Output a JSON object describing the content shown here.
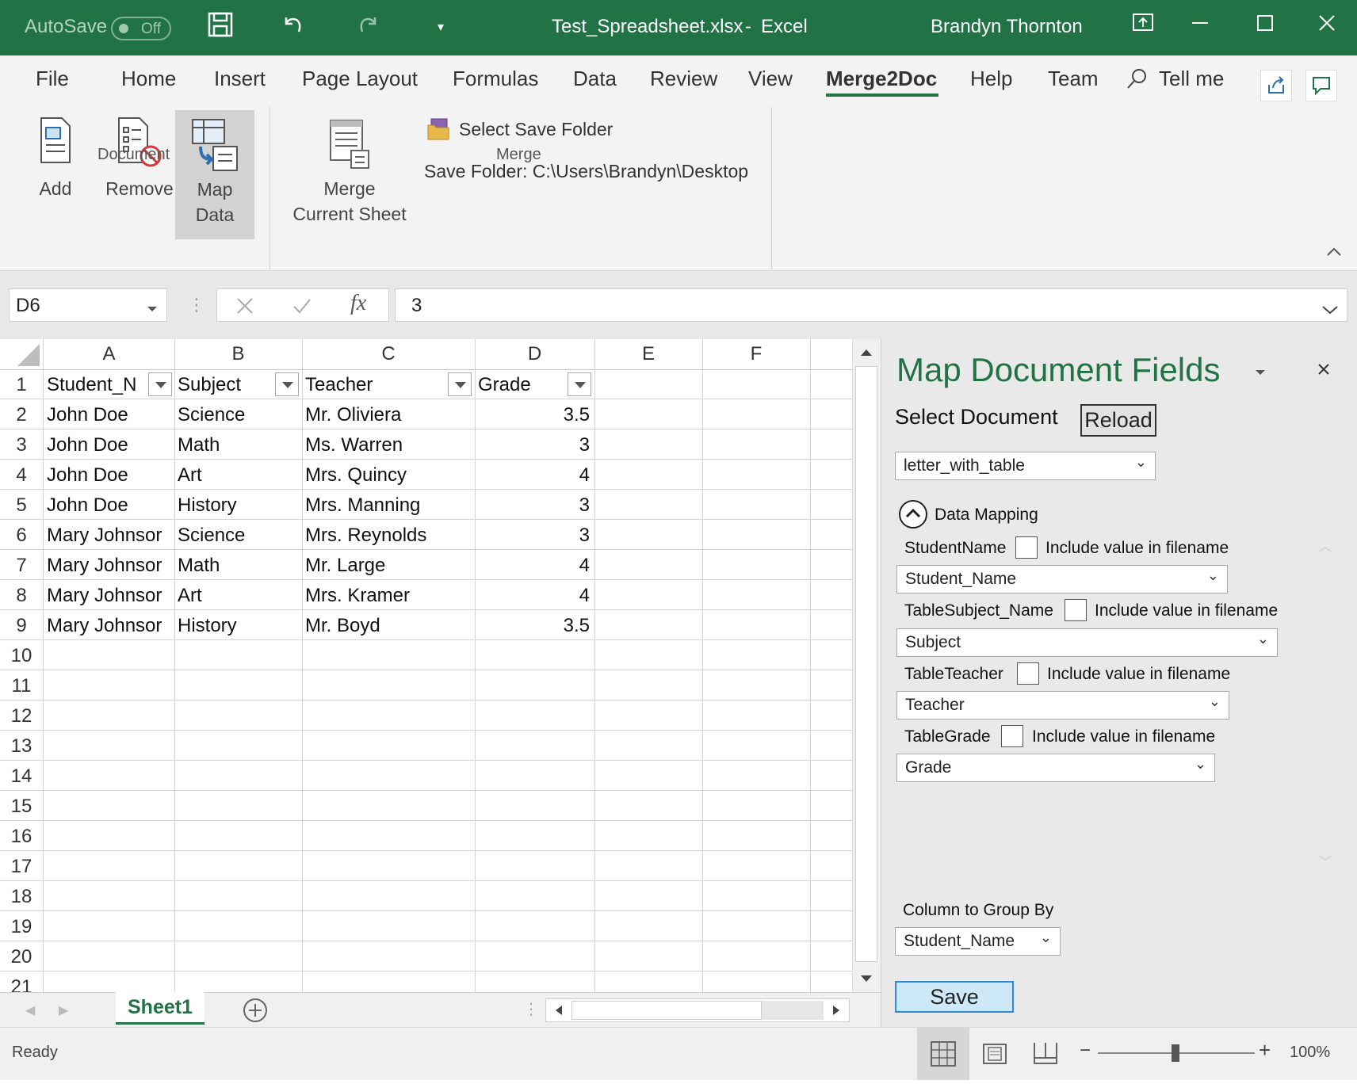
{
  "titlebar": {
    "autosave_label": "AutoSave",
    "autosave_state": "Off",
    "filename": "Test_Spreadsheet.xlsx",
    "separator": "-",
    "app": "Excel",
    "user": "Brandyn Thornton"
  },
  "tabs": [
    "File",
    "Home",
    "Insert",
    "Page Layout",
    "Formulas",
    "Data",
    "Review",
    "View",
    "Merge2Doc",
    "Help",
    "Team"
  ],
  "active_tab": "Merge2Doc",
  "tell_me": "Tell me",
  "ribbon": {
    "add": "Add",
    "remove": "Remove",
    "map_line1": "Map",
    "map_line2": "Data",
    "document_group": "Document",
    "merge_line1": "Merge",
    "merge_line2": "Current Sheet",
    "select_save_folder": "Select Save Folder",
    "save_folder": "Save Folder: C:\\Users\\Brandyn\\Desktop",
    "merge_group": "Merge"
  },
  "formula_bar": {
    "name_box": "D6",
    "fx": "fx",
    "value": "3"
  },
  "sheet": {
    "columns": [
      "A",
      "B",
      "C",
      "D",
      "E",
      "F"
    ],
    "row_numbers": [
      "1",
      "2",
      "3",
      "4",
      "5",
      "6",
      "7",
      "8",
      "9",
      "10",
      "11",
      "12",
      "13",
      "14",
      "15",
      "16",
      "17",
      "18",
      "19",
      "20",
      "21"
    ],
    "headers": [
      "Student_N",
      "Subject",
      "Teacher",
      "Grade"
    ],
    "rows": [
      [
        "John Doe",
        "Science",
        "Mr. Oliviera",
        "3.5"
      ],
      [
        "John Doe",
        "Math",
        "Ms. Warren",
        "3"
      ],
      [
        "John Doe",
        "Art",
        "Mrs. Quincy",
        "4"
      ],
      [
        "John Doe",
        "History",
        "Mrs. Manning",
        "3"
      ],
      [
        "Mary Johnsor",
        "Science",
        "Mrs. Reynolds",
        "3"
      ],
      [
        "Mary Johnsor",
        "Math",
        "Mr. Large",
        "4"
      ],
      [
        "Mary Johnsor",
        "Art",
        "Mrs. Kramer",
        "4"
      ],
      [
        "Mary Johnsor",
        "History",
        "Mr. Boyd",
        "3.5"
      ]
    ],
    "tab_name": "Sheet1"
  },
  "pane": {
    "title": "Map Document Fields",
    "select_document": "Select Document",
    "reload": "Reload",
    "document": "letter_with_table",
    "data_mapping": "Data Mapping",
    "include_label": "Include value in filename",
    "fields": [
      {
        "name": "StudentName",
        "value": "Student_Name"
      },
      {
        "name": "TableSubject_Name",
        "value": "Subject"
      },
      {
        "name": "TableTeacher",
        "value": "Teacher"
      },
      {
        "name": "TableGrade",
        "value": "Grade"
      }
    ],
    "group_by_label": "Column to Group By",
    "group_by_value": "Student_Name",
    "save": "Save"
  },
  "status": {
    "ready": "Ready",
    "zoom": "100%"
  },
  "colors": {
    "excel_green": "#217346",
    "pane_bg": "#e9e9e9",
    "save_btn_bg": "#cde8f7"
  }
}
